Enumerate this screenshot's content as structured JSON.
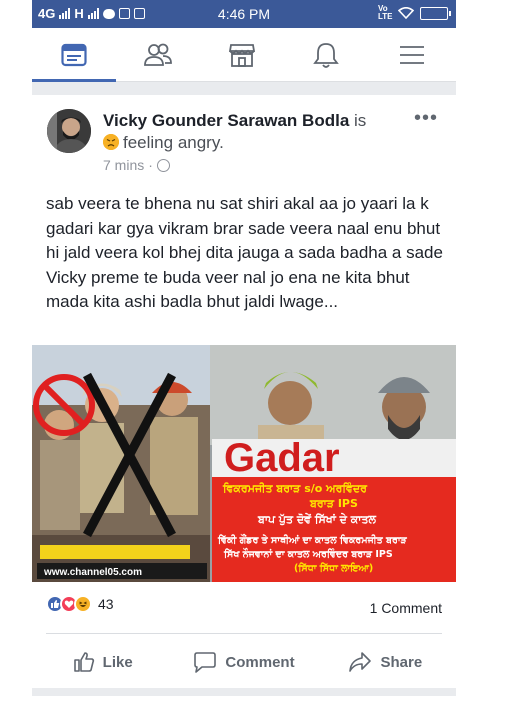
{
  "status_bar": {
    "network_left": "4G",
    "network_right": "H",
    "time": "4:46 PM",
    "volte": "Vo LTE"
  },
  "nav": {
    "items": [
      {
        "name": "news-feed",
        "icon": "news-feed-icon"
      },
      {
        "name": "friends",
        "icon": "friends-icon"
      },
      {
        "name": "marketplace",
        "icon": "marketplace-icon"
      },
      {
        "name": "notifications",
        "icon": "bell-icon"
      },
      {
        "name": "menu",
        "icon": "hamburger-menu-icon"
      }
    ],
    "active": "news-feed",
    "accent": "#4267b2"
  },
  "post": {
    "author": "Vicky Gounder Sarawan Bodla",
    "is_text": " is ",
    "feeling": "feeling angry.",
    "time": "7 mins",
    "separator": "·",
    "text": "sab veera te bhena nu sat shiri akal aa jo yaari la k gadari kar gya vikram brar sade veera naal enu bhut hi jald veera kol bhej dita jauga a sada badha a sade  Vicky preme te buda veer nal jo ena ne kita bhut mada kita ashi badla bhut jaldi lwage...",
    "image": {
      "banner_word": "Gadar",
      "watermark": "www.channel05.com",
      "caption_line1": "ਵਿਕਰਮਜੀਤ ਬਰਾੜ s/o ਅਰਵਿੰਦਰ",
      "caption_line2": "ਬਰਾੜ IPS",
      "caption_line3": "ਬਾਪ ਪੁੱਤ ਦੋਵੇਂ ਸਿੱਖਾਂ ਦੇ ਕਾਤਲ",
      "caption_line4": "ਵਿੱਕੀ ਗੌਂਡਰ ਤੇ ਸਾਥੀਆਂ ਦਾ ਕਾਤਲ ਵਿਕਰਮਜੀਤ ਬਰਾੜ",
      "caption_line5": "ਸਿੱਖ ਨੌਜਵਾਨਾਂ ਦਾ ਕਾਤਲ ਅਰਵਿੰਦਰ ਬਰਾੜ IPS",
      "caption_line6": "(ਸਿੱਧਾ ਸਿੱਧਾ ਲਾਇਆ)"
    },
    "reactions_count": "43",
    "comments": "1 Comment",
    "actions": {
      "like": "Like",
      "comment": "Comment",
      "share": "Share"
    }
  },
  "colors": {
    "brand": "#3b5998",
    "link_blue": "#4267b2",
    "love_red": "#f33e58",
    "haha_yellow": "#f7b125"
  }
}
